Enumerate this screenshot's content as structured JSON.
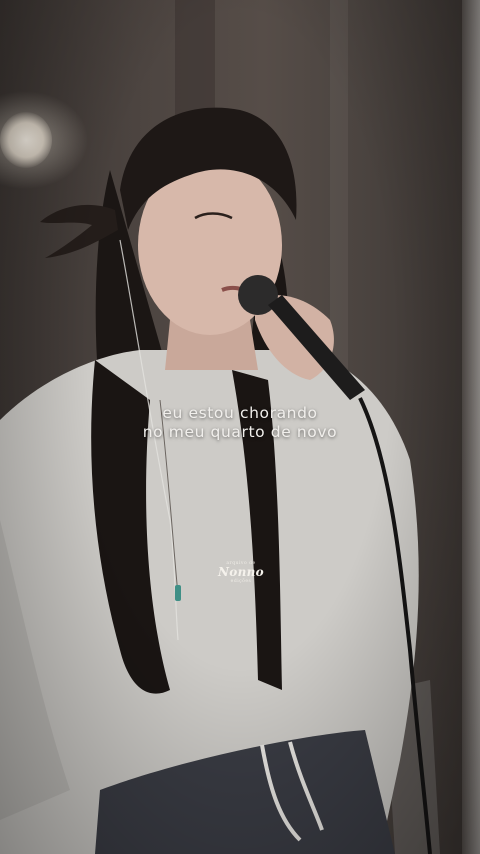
{
  "lyrics": {
    "line1": "eu estou chorando",
    "line2": "no meu quarto de novo"
  },
  "watermark": {
    "top_text": "arquivo de",
    "main_text": "Nonno",
    "bottom_text": "edições"
  },
  "colors": {
    "caption_text": "#f1efec",
    "wall": "#4d4541",
    "sweater": "#cfcdc9",
    "hair": "#1a1513"
  }
}
